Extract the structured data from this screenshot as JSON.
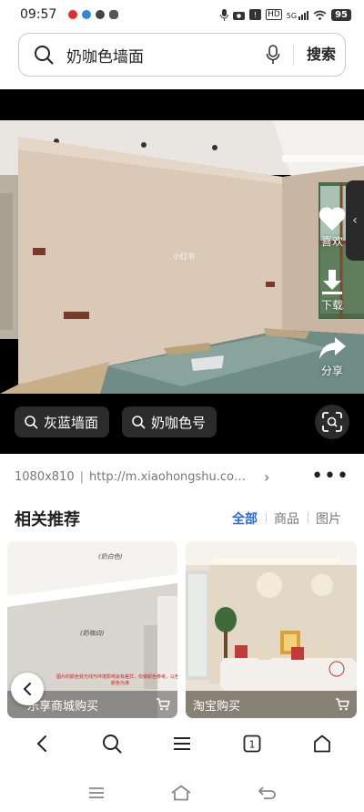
{
  "status_bar": {
    "time": "09:57",
    "network": "5G",
    "battery": "95"
  },
  "search": {
    "query": "奶咖色墙面",
    "button_label": "搜索"
  },
  "viewer": {
    "watermark": "小红书",
    "actions": [
      {
        "label": "喜欢",
        "icon": "heart-icon"
      },
      {
        "label": "下载",
        "icon": "download-icon"
      },
      {
        "label": "分享",
        "icon": "share-icon"
      }
    ],
    "chips": [
      "灰蓝墙面",
      "奶咖色号"
    ]
  },
  "info": {
    "dimensions": "1080x810",
    "url": "http://m.xiaohongshu.com/discovery/item"
  },
  "related": {
    "title": "相关推荐",
    "tabs": [
      "全部",
      "商品",
      "图片"
    ],
    "active_tab": "全部",
    "cards": [
      {
        "label": "乐享商城购买",
        "tag_top": "(奶白色)",
        "tag_mid": "(奶咖白)",
        "note": "图片的颜色受光线与环境影响会有差异，仅做颜色参考，以色卡颜色为准"
      },
      {
        "label": "淘宝购买"
      }
    ]
  },
  "colors": {
    "accent": "#2a6ad8",
    "wall": "#d9c9b6",
    "chip_bg": "#2b2b2b"
  }
}
